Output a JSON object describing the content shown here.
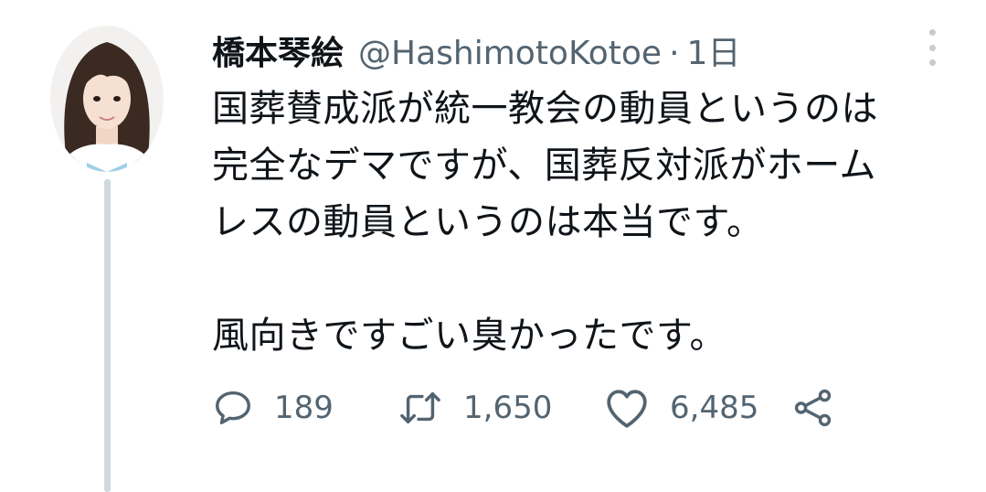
{
  "tweet": {
    "author": {
      "display_name": "橋本琴絵",
      "handle": "@HashimotoKotoe",
      "separator": "·",
      "time": "1日"
    },
    "text_lines": [
      "国葬賛成派が統一教会の動員というのは",
      "完全なデマですが、国葬反対派がホーム",
      "レスの動員というのは本当です。",
      "",
      "風向きですごい臭かったです。"
    ],
    "actions": {
      "reply_count": "189",
      "retweet_count": "1,650",
      "like_count": "6,485"
    },
    "icons": {
      "reply": "speech-bubble-icon",
      "retweet": "retweet-arrows-icon",
      "like": "heart-outline-icon",
      "share": "share-nodes-icon",
      "more": "vertical-dots-icon"
    },
    "colors": {
      "text_primary": "#0f1419",
      "text_secondary": "#536471",
      "thread_line": "#cfd9de"
    }
  }
}
